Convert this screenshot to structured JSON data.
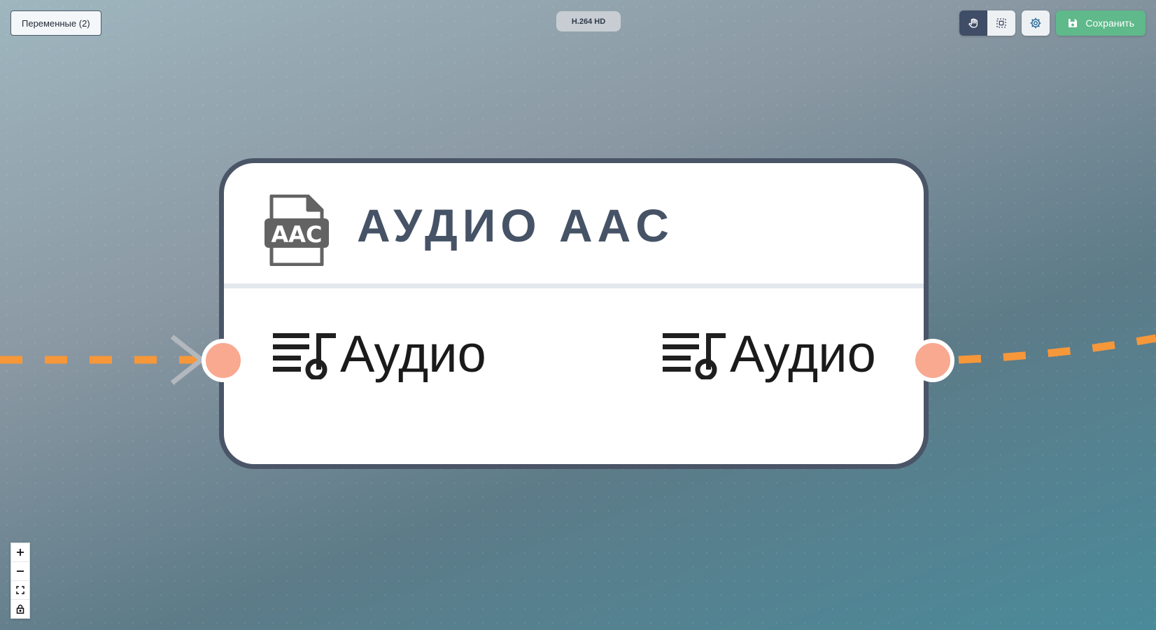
{
  "toolbar": {
    "variables_label": "Переменные (2)",
    "codec_badge": "H.264 HD",
    "save_label": "Сохранить",
    "icons": [
      "hand-icon",
      "select-icon",
      "gear-icon",
      "save-icon"
    ]
  },
  "node": {
    "title": "АУДИО AAC",
    "icon": "aac-file-icon",
    "input_port": {
      "label": "Аудио",
      "icon": "music-list-icon"
    },
    "output_port": {
      "label": "Аудио",
      "icon": "music-list-icon"
    }
  },
  "zoom_controls": [
    "zoom-in-icon",
    "zoom-out-icon",
    "fit-view-icon",
    "lock-icon"
  ],
  "colors": {
    "edge": "#f6973a",
    "handle": "#f8a98f",
    "node_border": "#4a5568",
    "title": "#465366",
    "save": "#5fb98a",
    "active_tool": "#3f4d66"
  }
}
